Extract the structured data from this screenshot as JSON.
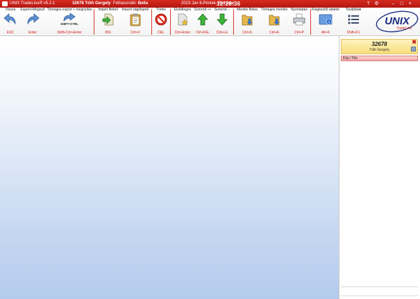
{
  "titlebar": {
    "app": "UNIX TradeLine® v5.2.1",
    "user": "32678 Tóth Gergely",
    "role_prefix": "Felhasználó:",
    "role": "Bella",
    "date": "2023 Jan 6.Péntek, Bolházai",
    "clock": "12:28:36"
  },
  "toolbar": [
    {
      "label": "Vissza",
      "key": "ESC",
      "icon": "back-arrow-icon"
    },
    {
      "label": "Export+Megnyit",
      "key": "Enter",
      "icon": "export-arrow-icon"
    },
    {
      "label": "Tömeges export + megnyitás",
      "key": "Shift+Ctrl+Enter",
      "icon": "bulk-export-icon",
      "icon_text": "SHIFT+CTRL"
    },
    {
      "label": "Import fileból",
      "key": "INS",
      "icon": "import-file-icon"
    },
    {
      "label": "Import vágólapról",
      "key": "Ctrl+V",
      "icon": "clipboard-icon"
    },
    {
      "label": "Törlés",
      "key": "DEL",
      "icon": "delete-icon"
    },
    {
      "label": "Elsődleges",
      "key": "Ctrl+Enter",
      "icon": "primary-star-icon"
    },
    {
      "label": "Sorrend ++",
      "key": "Ctrl+FEL",
      "icon": "order-up-icon"
    },
    {
      "label": "Sorrend --",
      "key": "Ctrl+LE",
      "icon": "order-down-icon"
    },
    {
      "label": "Mentés fileba",
      "key": "Ctrl+S",
      "icon": "save-file-icon"
    },
    {
      "label": "Tömeges mentés",
      "key": "Ctrl+A",
      "icon": "bulk-save-icon"
    },
    {
      "label": "Nyomtatás",
      "key": "Ctrl+P",
      "icon": "printer-icon"
    },
    {
      "label": "Kiegészítő adatok",
      "key": "Alt+K",
      "icon": "info-icon"
    },
    {
      "label": "Továbbiak",
      "key": "Shift+F1",
      "icon": "more-list-icon"
    }
  ],
  "right_panel": {
    "user_id": "32678",
    "user_name": "Tóth Gergely",
    "photo_label": "Kép / File"
  },
  "colors": {
    "accent_red": "#c41e14",
    "key_red": "#d01a10",
    "main_gradient_bottom": "#b4cbed"
  }
}
